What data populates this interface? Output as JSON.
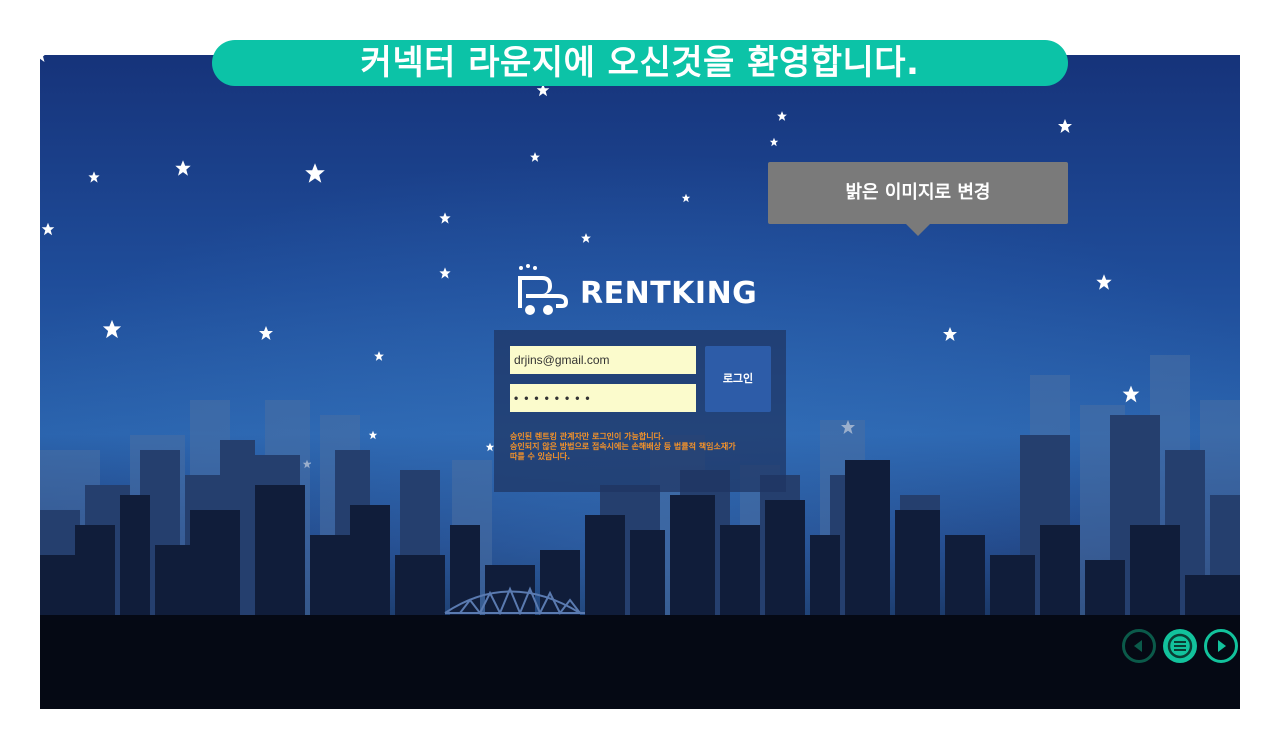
{
  "banner": {
    "text": "커넥터 라운지에 오신것을 환영합니다."
  },
  "tooltip": {
    "text": "밝은 이미지로 변경"
  },
  "logo": {
    "text": "RENTKING",
    "icon": "rentking-logo-icon"
  },
  "login": {
    "email_value": "drjins@gmail.com",
    "password_value": "••••••••",
    "button_label": "로그인",
    "notice_lines": [
      "승인된 렌트킹 관계자만 로그인이 가능합니다.",
      "승인되지 않은 방법으로 접속시에는 손해배상 등 법률적 책임소재가",
      "따를 수 있습니다."
    ]
  },
  "nav": {
    "prev_icon": "previous-icon",
    "menu_icon": "menu-icon",
    "next_icon": "next-icon"
  },
  "colors": {
    "banner": "#0cc3a7",
    "tooltip": "#7a7a7a",
    "login_button": "#2d5ca8",
    "notice_text": "#f3922a",
    "input_bg": "#fbfbcc"
  }
}
